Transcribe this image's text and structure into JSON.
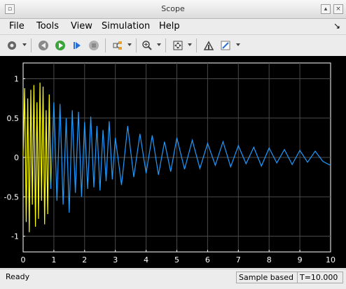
{
  "window": {
    "title": "Scope"
  },
  "menu": {
    "file": "File",
    "tools": "Tools",
    "view": "View",
    "simulation": "Simulation",
    "help": "Help"
  },
  "toolbar": {
    "buttons": [
      "parameters-gear-icon",
      "step-back-icon",
      "run-icon",
      "step-forward-icon",
      "stop-icon",
      "signal-selector-icon",
      "zoom-icon",
      "autoscale-icon",
      "highlight-block-icon",
      "style-edit-icon"
    ]
  },
  "status": {
    "ready": "Ready",
    "mode": "Sample based",
    "time": "T=10.000"
  },
  "colors": {
    "plot_bg": "#000000",
    "axes": "#ffffff",
    "grid": "#4a4a4a",
    "series_active": "#1e9bff",
    "series_prev": "#ffff00"
  },
  "chart_data": {
    "type": "line",
    "xlim": [
      0,
      10
    ],
    "ylim": [
      -1.2,
      1.2
    ],
    "xticks": [
      "0",
      "1",
      "2",
      "3",
      "4",
      "5",
      "6",
      "7",
      "8",
      "9",
      "10"
    ],
    "yticks": [
      "1",
      "0.5",
      "0",
      "-0.5",
      "-1"
    ],
    "ytick_values": [
      1,
      0.5,
      0,
      -0.5,
      -1
    ],
    "grid": true,
    "series": [
      {
        "color": "#ffff00",
        "x": [
          0.0,
          0.05,
          0.1,
          0.15,
          0.2,
          0.25,
          0.3,
          0.35,
          0.4,
          0.45,
          0.5,
          0.55,
          0.6,
          0.65,
          0.7,
          0.75,
          0.8,
          0.85,
          0.9
        ],
        "y": [
          0.02,
          0.88,
          -0.82,
          0.75,
          -0.95,
          0.86,
          -0.6,
          0.92,
          -0.88,
          0.7,
          -0.78,
          0.95,
          -0.55,
          0.9,
          -0.85,
          0.6,
          -0.72,
          0.8,
          -0.4
        ]
      },
      {
        "color": "#1e9bff",
        "x": [
          0.9,
          1.0,
          1.1,
          1.2,
          1.3,
          1.4,
          1.5,
          1.6,
          1.7,
          1.8,
          1.9,
          2.0,
          2.1,
          2.2,
          2.3,
          2.4,
          2.5,
          2.6,
          2.7,
          2.8,
          2.9,
          3.0,
          3.2,
          3.4,
          3.6,
          3.8,
          4.0,
          4.2,
          4.4,
          4.6,
          4.8,
          5.0,
          5.25,
          5.5,
          5.75,
          6.0,
          6.25,
          6.5,
          6.75,
          7.0,
          7.25,
          7.5,
          7.75,
          8.0,
          8.25,
          8.5,
          8.75,
          9.0,
          9.25,
          9.5,
          9.75,
          10.0
        ],
        "y": [
          -0.4,
          0.7,
          -0.55,
          0.68,
          -0.6,
          0.5,
          -0.7,
          0.6,
          -0.45,
          0.58,
          -0.5,
          0.45,
          -0.4,
          0.52,
          -0.38,
          0.4,
          -0.42,
          0.35,
          -0.3,
          0.46,
          -0.28,
          0.25,
          -0.35,
          0.4,
          -0.25,
          0.3,
          -0.2,
          0.28,
          -0.22,
          0.2,
          -0.18,
          0.25,
          -0.15,
          0.22,
          -0.14,
          0.18,
          -0.1,
          0.2,
          -0.12,
          0.15,
          -0.08,
          0.13,
          -0.11,
          0.12,
          -0.07,
          0.1,
          -0.09,
          0.09,
          -0.06,
          0.08,
          -0.05,
          -0.1
        ]
      }
    ]
  }
}
